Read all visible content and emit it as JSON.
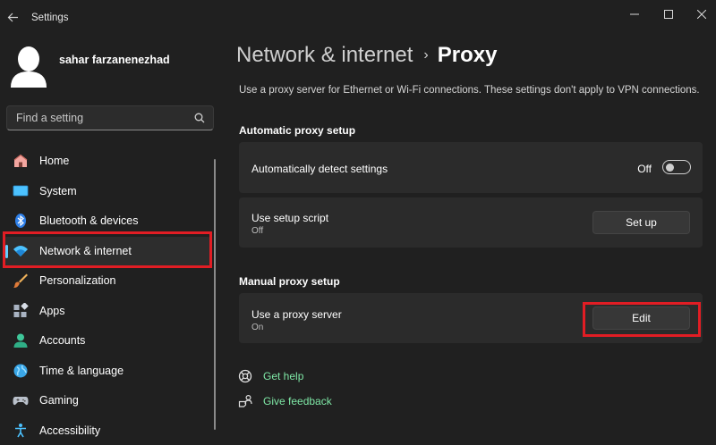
{
  "window": {
    "title": "Settings"
  },
  "user": {
    "name": "sahar farzanenezhad"
  },
  "search": {
    "placeholder": "Find a setting"
  },
  "sidebar": {
    "items": [
      {
        "label": "Home",
        "icon": "home-icon",
        "active": false
      },
      {
        "label": "System",
        "icon": "system-icon",
        "active": false
      },
      {
        "label": "Bluetooth & devices",
        "icon": "bluetooth-icon",
        "active": false
      },
      {
        "label": "Network & internet",
        "icon": "wifi-icon",
        "active": true
      },
      {
        "label": "Personalization",
        "icon": "brush-icon",
        "active": false
      },
      {
        "label": "Apps",
        "icon": "apps-icon",
        "active": false
      },
      {
        "label": "Accounts",
        "icon": "accounts-icon",
        "active": false
      },
      {
        "label": "Time & language",
        "icon": "globe-icon",
        "active": false
      },
      {
        "label": "Gaming",
        "icon": "gamepad-icon",
        "active": false
      },
      {
        "label": "Accessibility",
        "icon": "accessibility-icon",
        "active": false
      }
    ]
  },
  "breadcrumb": {
    "parent": "Network & internet",
    "separator": "›",
    "current": "Proxy"
  },
  "page": {
    "description": "Use a proxy server for Ethernet or Wi-Fi connections. These settings don't apply to VPN connections."
  },
  "automatic": {
    "title": "Automatic proxy setup",
    "detect": {
      "label": "Automatically detect settings",
      "state": "Off"
    },
    "script": {
      "label": "Use setup script",
      "status": "Off",
      "button": "Set up"
    }
  },
  "manual": {
    "title": "Manual proxy setup",
    "proxy": {
      "label": "Use a proxy server",
      "status": "On",
      "button": "Edit"
    }
  },
  "help": {
    "get_help": "Get help",
    "feedback": "Give feedback"
  },
  "colors": {
    "accent": "#60cdff",
    "highlight": "#e11d24",
    "link": "#7fe8a6",
    "background": "#202020",
    "card": "#2b2b2b"
  }
}
